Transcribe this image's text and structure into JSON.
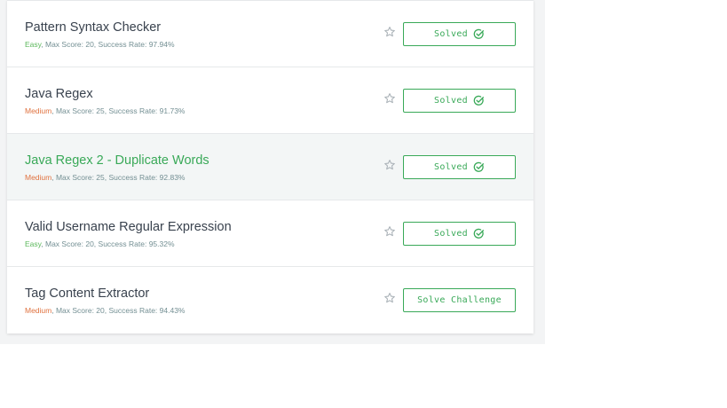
{
  "challenges": [
    {
      "title": "Pattern Syntax Checker",
      "difficulty": "Easy",
      "meta_rest": ", Max Score: 20, Success Rate: 97.94%",
      "button_label": "Solved",
      "solved": true
    },
    {
      "title": "Java Regex",
      "difficulty": "Medium",
      "meta_rest": ", Max Score: 25, Success Rate: 91.73%",
      "button_label": "Solved",
      "solved": true
    },
    {
      "title": "Java Regex 2 - Duplicate Words",
      "difficulty": "Medium",
      "meta_rest": ", Max Score: 25, Success Rate: 92.83%",
      "button_label": "Solved",
      "solved": true
    },
    {
      "title": "Valid Username Regular Expression",
      "difficulty": "Easy",
      "meta_rest": ", Max Score: 20, Success Rate: 95.32%",
      "button_label": "Solved",
      "solved": true
    },
    {
      "title": "Tag Content Extractor",
      "difficulty": "Medium",
      "meta_rest": ", Max Score: 20, Success Rate: 94.43%",
      "button_label": "Solve Challenge",
      "solved": false
    }
  ],
  "colors": {
    "accent_green": "#39a958",
    "easy": "#5cb85c",
    "medium": "#e0723f",
    "title": "#39424e",
    "meta": "#738f93"
  },
  "icons": {
    "bookmark": "star-outline-icon",
    "solved": "check-circle-icon"
  }
}
